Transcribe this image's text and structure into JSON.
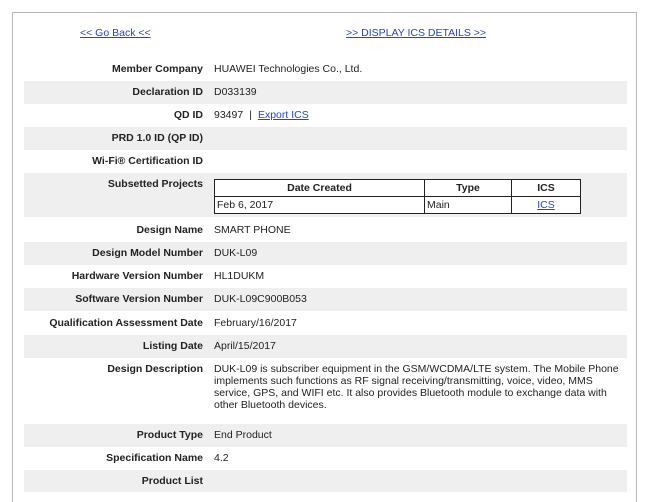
{
  "nav": {
    "back": "<< Go Back <<",
    "display_ics": ">> DISPLAY ICS DETAILS >>"
  },
  "fields": {
    "member_company": {
      "label": "Member Company",
      "value": "HUAWEI Technologies Co., Ltd."
    },
    "declaration_id": {
      "label": "Declaration ID",
      "value": "D033139"
    },
    "qd_id": {
      "label": "QD ID",
      "value": "93497",
      "separator": "|",
      "link": "Export ICS"
    },
    "prd_id": {
      "label": "PRD 1.0 ID (QP ID)",
      "value": ""
    },
    "wifi_cert": {
      "label": "Wi-Fi® Certification ID",
      "value": ""
    },
    "subsetted_projects": {
      "label": "Subsetted Projects"
    },
    "design_name": {
      "label": "Design Name",
      "value": "SMART PHONE"
    },
    "design_model": {
      "label": "Design Model Number",
      "value": "DUK-L09"
    },
    "hardware_version": {
      "label": "Hardware Version Number",
      "value": "HL1DUKM"
    },
    "software_version": {
      "label": "Software Version Number",
      "value": "DUK-L09C900B053"
    },
    "qa_date": {
      "label": "Qualification Assessment Date",
      "value": "February/16/2017"
    },
    "listing_date": {
      "label": "Listing Date",
      "value": "April/15/2017"
    },
    "design_description": {
      "label": "Design Description",
      "value": "DUK-L09 is subscriber equipment in the GSM/WCDMA/LTE system. The Mobile Phone implements such functions as RF signal receiving/transmitting, voice, video, MMS service, GPS, and WIFI etc. It also provides Bluetooth module to exchange data with other Bluetooth devices."
    },
    "product_type": {
      "label": "Product Type",
      "value": "End Product"
    },
    "spec_name": {
      "label": "Specification Name",
      "value": "4.2"
    },
    "product_list": {
      "label": "Product List",
      "value": ""
    }
  },
  "subsetted_table": {
    "headers": [
      "Date Created",
      "Type",
      "ICS"
    ],
    "rows": [
      [
        "Feb 6, 2017",
        "Main",
        "ICS"
      ]
    ]
  }
}
